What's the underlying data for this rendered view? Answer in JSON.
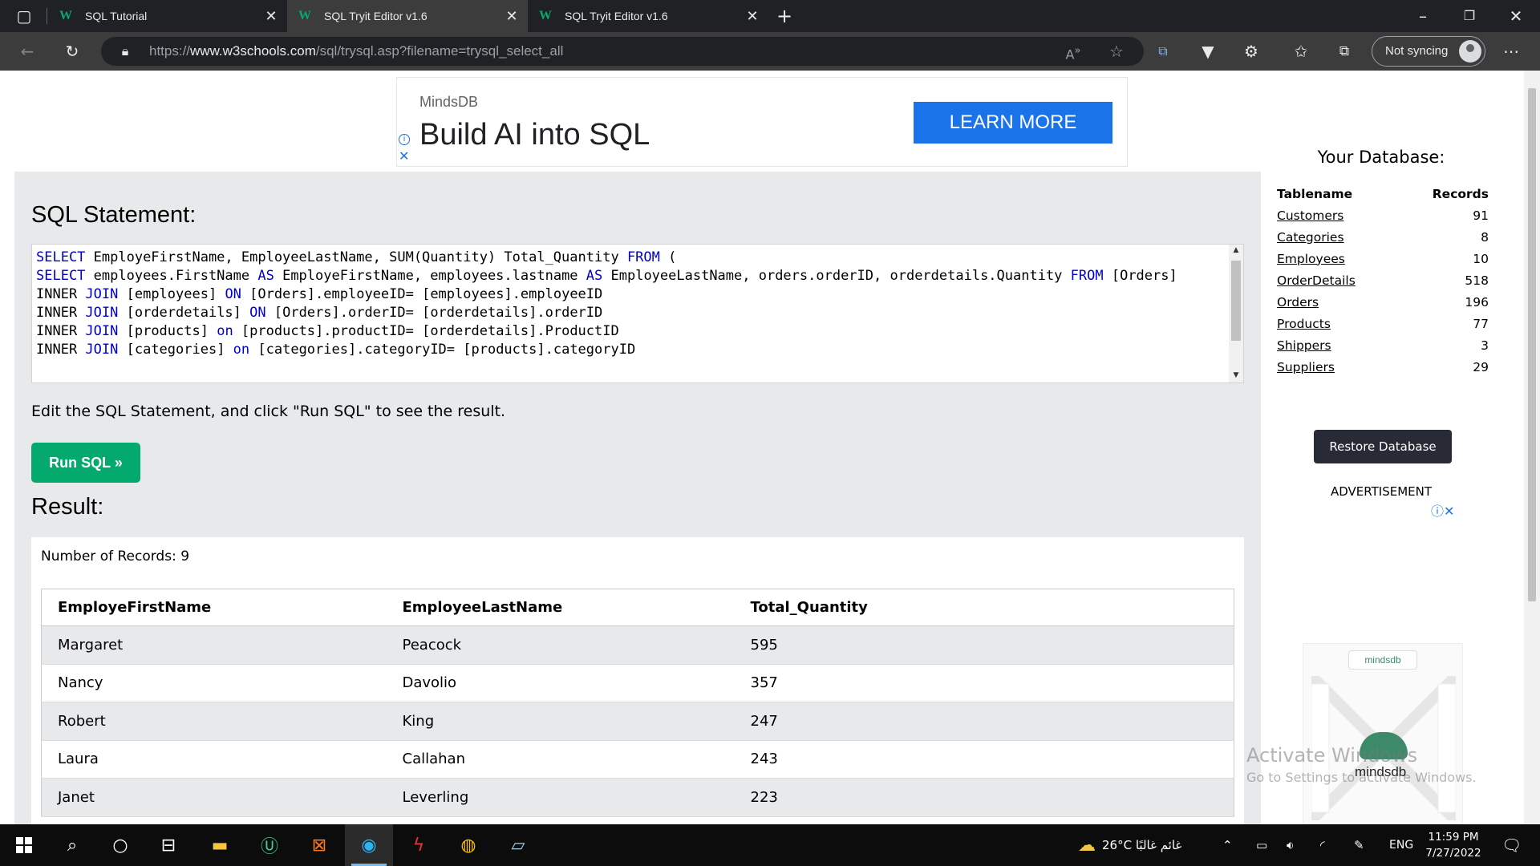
{
  "browser": {
    "tabs": [
      {
        "title": "SQL Tutorial",
        "favicon": "W",
        "active": false
      },
      {
        "title": "SQL Tryit Editor v1.6",
        "favicon": "W",
        "active": true
      },
      {
        "title": "SQL Tryit Editor v1.6",
        "favicon": "W",
        "active": false
      }
    ],
    "url_prefix": "https://",
    "url_host": "www.w3schools.com",
    "url_path": "/sql/trysql.asp?filename=trysql_select_all",
    "sync_label": "Not syncing"
  },
  "ad_banner": {
    "brand": "MindsDB",
    "headline": "Build AI into SQL",
    "cta": "LEARN MORE"
  },
  "editor": {
    "heading": "SQL Statement:",
    "lines": [
      [
        [
          "kw",
          "SELECT"
        ],
        [
          "t",
          " EmployeFirstName, EmployeeLastName, SUM(Quantity) Total_Quantity "
        ],
        [
          "kw",
          "FROM"
        ],
        [
          "t",
          " ("
        ]
      ],
      [
        [
          "kw",
          "SELECT"
        ],
        [
          "t",
          " employees.FirstName "
        ],
        [
          "kw",
          "AS"
        ],
        [
          "t",
          " EmployeFirstName, employees.lastname "
        ],
        [
          "kw",
          "AS"
        ],
        [
          "t",
          " EmployeeLastName, orders.orderID, orderdetails.Quantity "
        ],
        [
          "kw",
          "FROM"
        ],
        [
          "t",
          " [Orders]"
        ]
      ],
      [
        [
          "t",
          "INNER "
        ],
        [
          "kw",
          "JOIN"
        ],
        [
          "t",
          " [employees] "
        ],
        [
          "kw",
          "ON"
        ],
        [
          "t",
          " [Orders].employeeID= [employees].employeeID"
        ]
      ],
      [
        [
          "t",
          "INNER "
        ],
        [
          "kw",
          "JOIN"
        ],
        [
          "t",
          " [orderdetails] "
        ],
        [
          "kw",
          "ON"
        ],
        [
          "t",
          " [Orders].orderID= [orderdetails].orderID"
        ]
      ],
      [
        [
          "t",
          "INNER "
        ],
        [
          "kw",
          "JOIN"
        ],
        [
          "t",
          " [products] "
        ],
        [
          "kw",
          "on"
        ],
        [
          "t",
          " [products].productID= [orderdetails].ProductID"
        ]
      ],
      [
        [
          "t",
          "INNER "
        ],
        [
          "kw",
          "JOIN"
        ],
        [
          "t",
          " [categories] "
        ],
        [
          "kw",
          "on"
        ],
        [
          "t",
          " [categories].categoryID= [products].categoryID"
        ]
      ]
    ],
    "instruction": "Edit the SQL Statement, and click \"Run SQL\" to see the result.",
    "run_label": "Run SQL »"
  },
  "result": {
    "heading": "Result:",
    "record_count": "Number of Records: 9",
    "columns": [
      "EmployeFirstName",
      "EmployeeLastName",
      "Total_Quantity"
    ],
    "rows": [
      [
        "Margaret",
        "Peacock",
        "595"
      ],
      [
        "Nancy",
        "Davolio",
        "357"
      ],
      [
        "Robert",
        "King",
        "247"
      ],
      [
        "Laura",
        "Callahan",
        "243"
      ],
      [
        "Janet",
        "Leverling",
        "223"
      ]
    ]
  },
  "database": {
    "title": "Your Database:",
    "col_table": "Tablename",
    "col_records": "Records",
    "tables": [
      {
        "name": "Customers",
        "records": "91"
      },
      {
        "name": "Categories",
        "records": "8"
      },
      {
        "name": "Employees",
        "records": "10"
      },
      {
        "name": "OrderDetails",
        "records": "518"
      },
      {
        "name": "Orders",
        "records": "196"
      },
      {
        "name": "Products",
        "records": "77"
      },
      {
        "name": "Shippers",
        "records": "3"
      },
      {
        "name": "Suppliers",
        "records": "29"
      }
    ],
    "restore_label": "Restore Database",
    "advertisement_label": "ADVERTISEMENT"
  },
  "side_ad": {
    "logo_text": "mindsdb",
    "word": "mindsdb"
  },
  "watermark": {
    "line1": "Activate Windows",
    "line2": "Go to Settings to activate Windows."
  },
  "taskbar": {
    "weather": "26°C  غائم غالبًا",
    "language": "ENG",
    "time": "11:59 PM",
    "date": "7/27/2022"
  },
  "colors": {
    "w3_green": "#04aa6d",
    "keyword_blue": "#0000cd",
    "panel_gray": "#e7e9eb"
  }
}
